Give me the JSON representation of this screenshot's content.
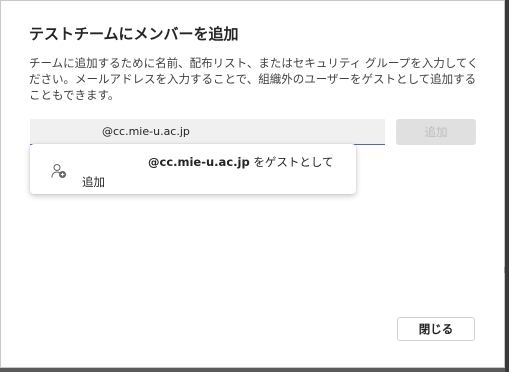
{
  "dialog": {
    "title": "テストチームにメンバーを追加",
    "description": "チームに追加するために名前、配布リスト、またはセキュリティ グループを入力してください。メールアドレスを入力することで、組織外のユーザーをゲストとして追加することもできます。"
  },
  "search": {
    "value": "@cc.mie-u.ac.jp",
    "placeholder": ""
  },
  "add_button": {
    "label": "追加",
    "enabled": false
  },
  "suggestion": {
    "icon": "add-guest-icon",
    "email": "@cc.mie-u.ac.jp",
    "suffix": " をゲストとして追加"
  },
  "close_button": {
    "label": "閉じる"
  },
  "colors": {
    "accent": "#5b5fc7",
    "disabled_bg": "#e0e0e0",
    "disabled_text": "#bdbdbd"
  }
}
